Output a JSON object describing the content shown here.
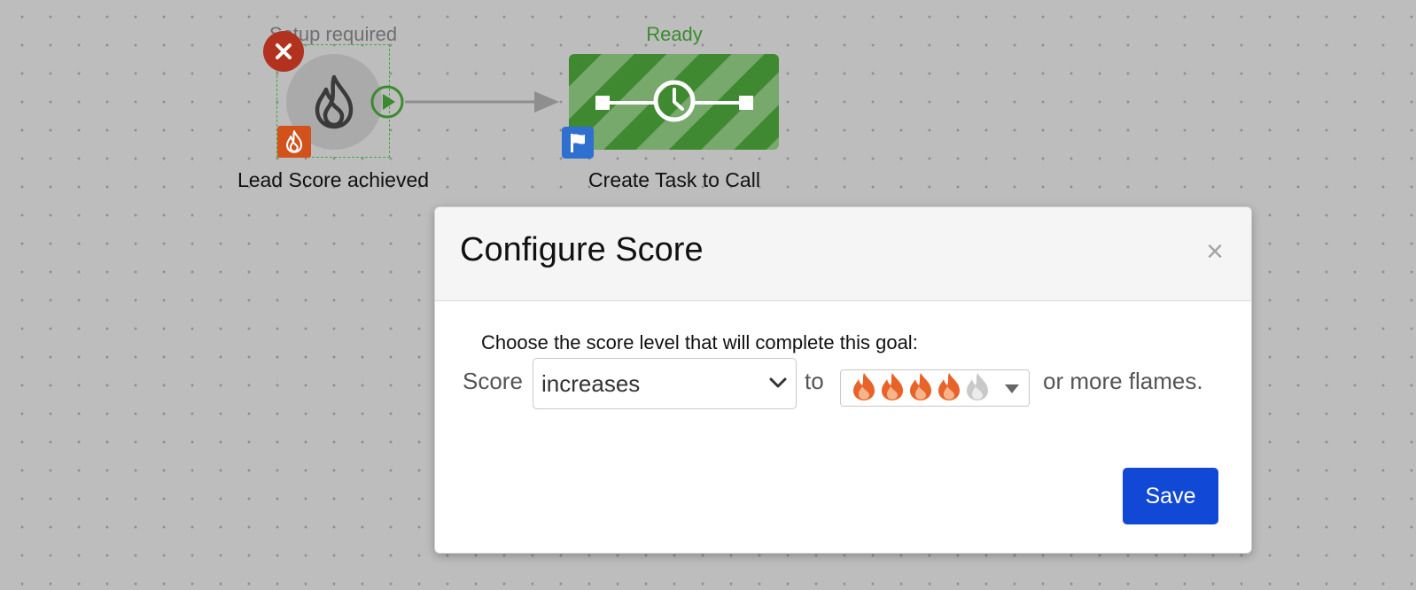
{
  "workflow": {
    "goal_node": {
      "status": "Setup required",
      "label": "Lead Score achieved",
      "status_color": "#6f6f6f"
    },
    "task_node": {
      "status": "Ready",
      "label": "Create Task to Call",
      "status_color": "#3b8b2e"
    }
  },
  "modal": {
    "title": "Configure Score",
    "close_symbol": "×",
    "instruction": "Choose the score level that will complete this goal:",
    "score_word": "Score",
    "direction_value": "increases",
    "to_word": "to",
    "flames_selected": 4,
    "flames_total": 5,
    "suffix": "or more flames.",
    "save_label": "Save"
  },
  "colors": {
    "accent_blue": "#1148d6",
    "delete_red": "#b2321f",
    "score_orange": "#d2521c",
    "task_green": "#3f8a30",
    "flag_blue": "#2f6fd0"
  },
  "icons": [
    "close-icon",
    "flame-icon",
    "play-circle-icon",
    "clock-icon",
    "flag-icon",
    "chevron-down-icon",
    "caret-down-icon"
  ]
}
